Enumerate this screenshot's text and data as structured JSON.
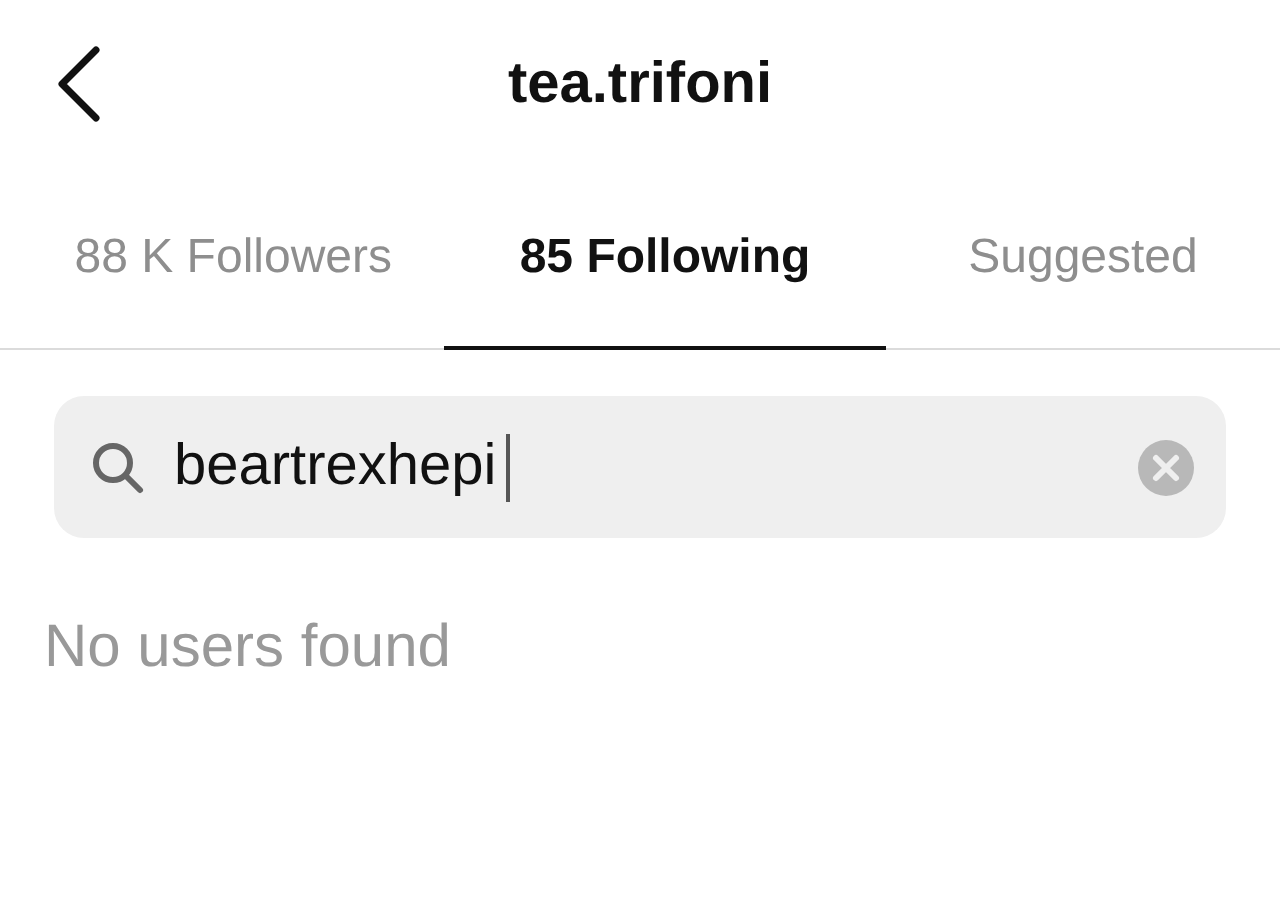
{
  "header": {
    "title": "tea.trifoni"
  },
  "tabs": [
    {
      "label": "88 K Followers",
      "selected": false
    },
    {
      "label": "85 Following",
      "selected": true
    },
    {
      "label": "Suggested",
      "selected": false
    }
  ],
  "search": {
    "value": "beartrexhepi"
  },
  "message": "No users found"
}
